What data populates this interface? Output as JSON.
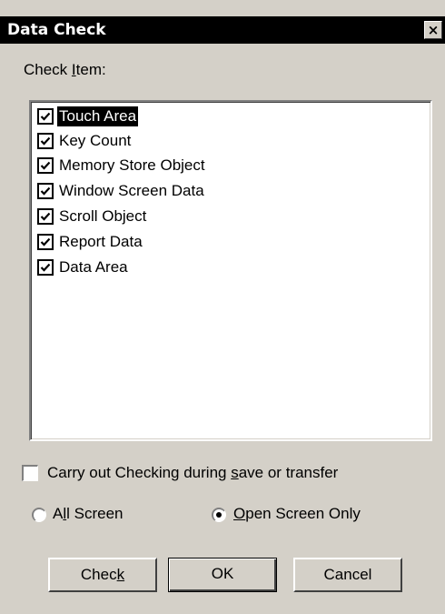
{
  "window": {
    "title": "Data Check",
    "close_glyph": "×"
  },
  "check_item_label": {
    "before": "Check ",
    "accel": "I",
    "after": "tem:"
  },
  "check_items": [
    {
      "label": "Touch Area",
      "checked": true,
      "selected": true
    },
    {
      "label": "Key Count",
      "checked": true,
      "selected": false
    },
    {
      "label": "Memory Store Object",
      "checked": true,
      "selected": false
    },
    {
      "label": "Window Screen Data",
      "checked": true,
      "selected": false
    },
    {
      "label": "Scroll Object",
      "checked": true,
      "selected": false
    },
    {
      "label": "Report Data",
      "checked": true,
      "selected": false
    },
    {
      "label": "Data Area",
      "checked": true,
      "selected": false
    }
  ],
  "carry_out": {
    "before": "Carry out Checking during ",
    "accel": "s",
    "after": "ave or transfer",
    "checked": false
  },
  "scope": {
    "all_screen": {
      "before": "A",
      "accel": "l",
      "after": "l Screen",
      "selected": false
    },
    "open_screen_only": {
      "before": "",
      "accel": "O",
      "after": "pen Screen Only",
      "selected": true
    }
  },
  "buttons": {
    "check": {
      "before": "Chec",
      "accel": "k",
      "after": ""
    },
    "ok": {
      "label": "OK"
    },
    "cancel": {
      "label": "Cancel"
    }
  },
  "colors": {
    "dialog_face": "#d4d0c8",
    "title_bar": "#000000",
    "selection": "#000000"
  },
  "icons": {
    "close": "close-icon",
    "checkmark": "checkmark-icon",
    "radio_dot": "radio-dot-icon"
  }
}
